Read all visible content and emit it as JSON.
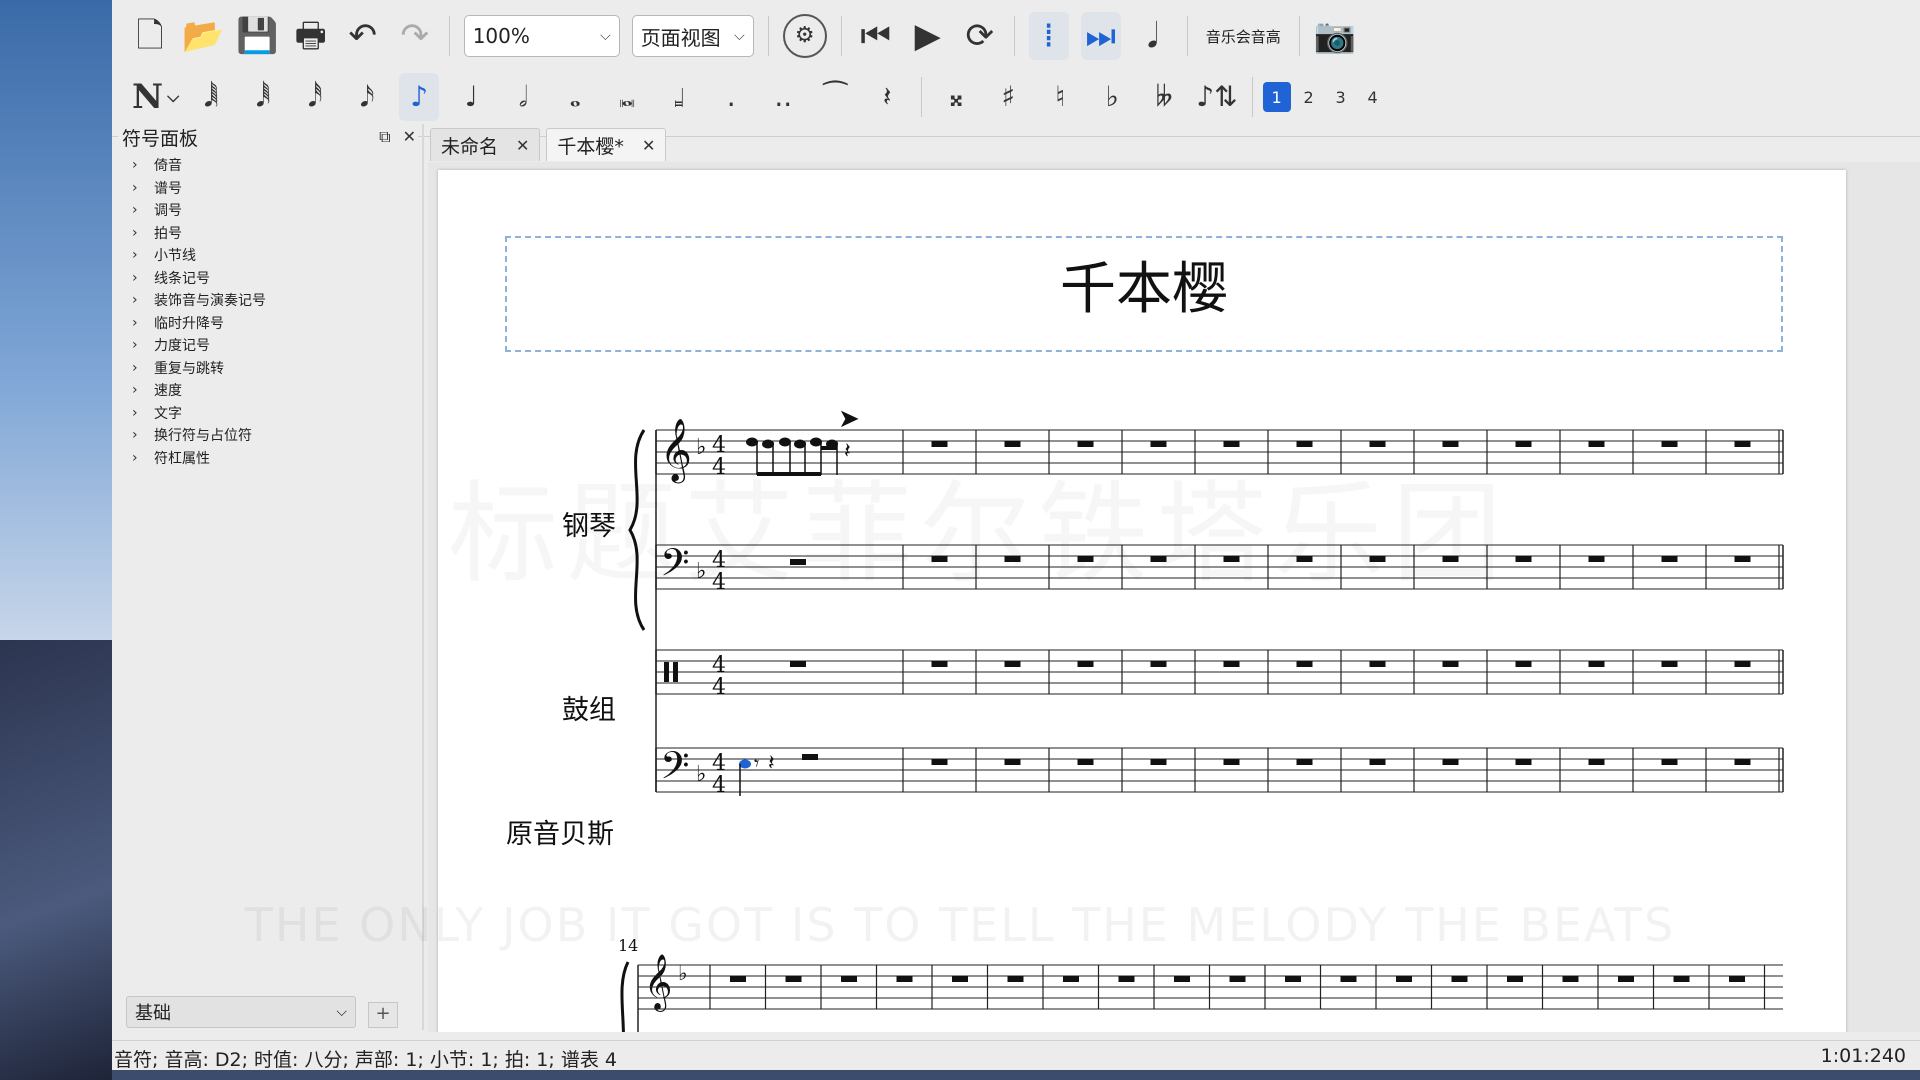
{
  "toolbar": {
    "zoom_value": "100%",
    "view_mode": "页面视图",
    "concert_pitch_label": "音乐会音高",
    "voices": [
      "1",
      "2",
      "3",
      "4"
    ],
    "active_voice": "1"
  },
  "palette": {
    "title": "符号面板",
    "items": [
      "倚音",
      "谱号",
      "调号",
      "拍号",
      "小节线",
      "线条记号",
      "装饰音与演奏记号",
      "临时升降号",
      "力度记号",
      "重复与跳转",
      "速度",
      "文字",
      "换行符与占位符",
      "符杠属性"
    ],
    "workspace": "基础",
    "add_label": "+"
  },
  "tabs": [
    {
      "label": "未命名",
      "close": "✕"
    },
    {
      "label": "千本樱*",
      "close": "✕"
    }
  ],
  "score": {
    "title": "千本樱",
    "instruments": [
      "钢琴",
      "鼓组",
      "原音贝斯"
    ],
    "next_system_measure_number": "14",
    "key_signature": "♭",
    "time_signature": "4/4"
  },
  "overlay": {
    "watermark_text": "标题艾菲尔铁塔乐团",
    "subtitle_text": "THE ONLY JOB IT GOT IS TO TELL THE MELODY THE BEATS"
  },
  "status": {
    "text": "音符; 音高: D2; 时值: 八分; 声部: 1;  小节: 1; 拍: 1; 谱表 4",
    "position": "1:01:240"
  },
  "colors": {
    "selection_blue": "#1f63d4",
    "title_frame": "#8fb2da",
    "palette_bg": "#ececec"
  }
}
